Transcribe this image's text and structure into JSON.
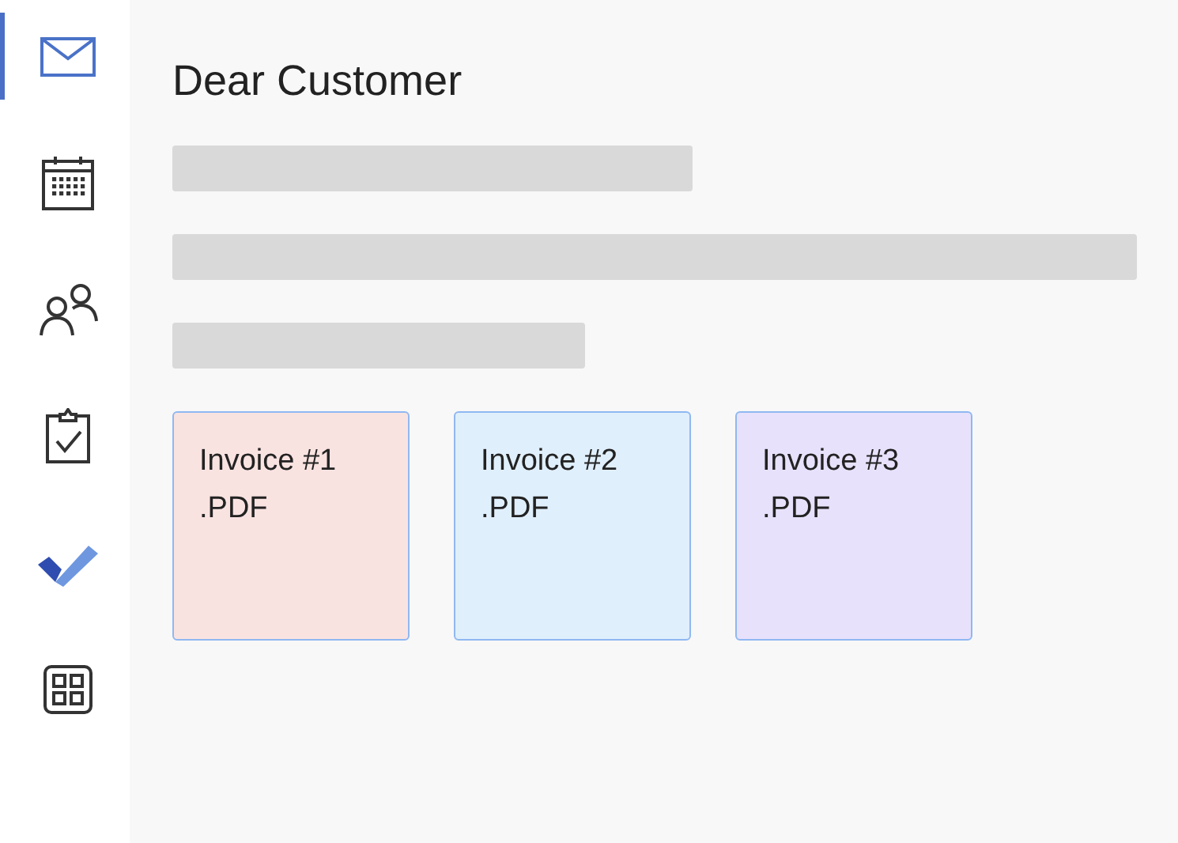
{
  "sidebar": {
    "items": [
      {
        "kind": "mail",
        "selected": true
      },
      {
        "kind": "calendar",
        "selected": false
      },
      {
        "kind": "people",
        "selected": false
      },
      {
        "kind": "clipboard",
        "selected": false
      },
      {
        "kind": "todo",
        "selected": false
      },
      {
        "kind": "apps",
        "selected": false
      }
    ]
  },
  "message": {
    "greeting": "Dear Customer",
    "attachments": [
      {
        "name": "Invoice #1",
        "extension": ".PDF",
        "color": "#f9e3e1"
      },
      {
        "name": "Invoice #2",
        "extension": ".PDF",
        "color": "#e0effc"
      },
      {
        "name": "Invoice #3",
        "extension": ".PDF",
        "color": "#e8e1fb"
      }
    ]
  }
}
